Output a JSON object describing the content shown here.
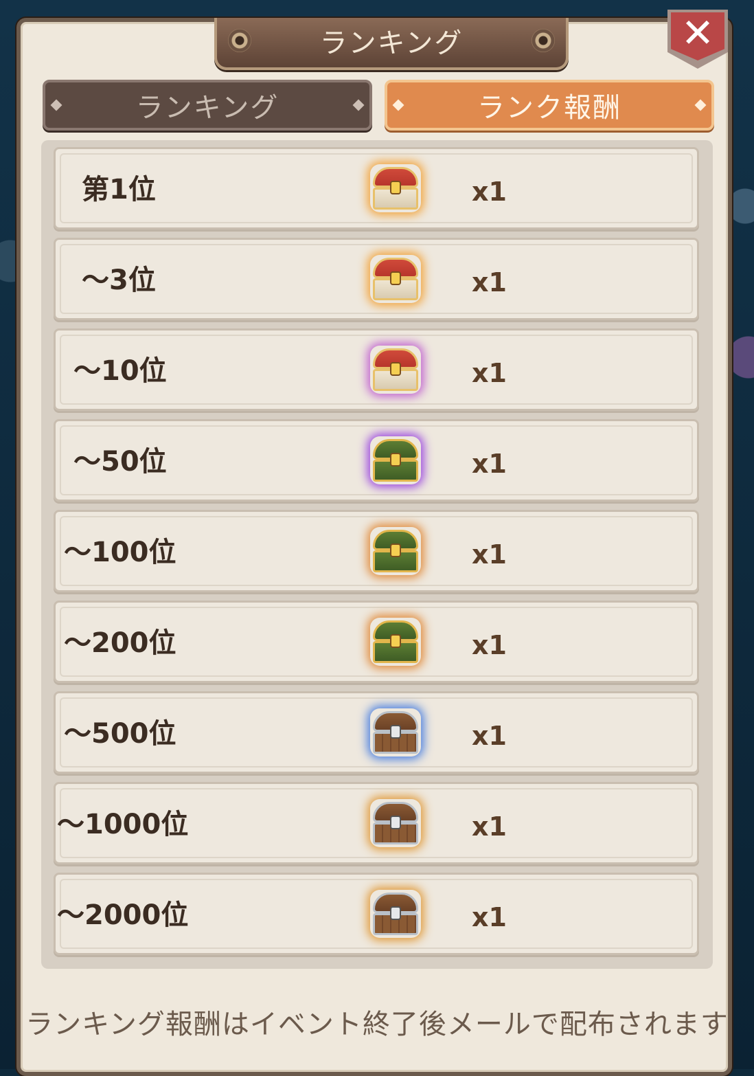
{
  "header": {
    "title": "ランキング",
    "close_label": "✕"
  },
  "tabs": [
    {
      "label": "ランキング",
      "active": false
    },
    {
      "label": "ランク報酬",
      "active": true
    }
  ],
  "rewards": [
    {
      "rank": "第1位",
      "chest": "red-gold-chest",
      "qty": "x1"
    },
    {
      "rank": "～3位",
      "chest": "red-gold-chest",
      "qty": "x1"
    },
    {
      "rank": "～10位",
      "chest": "red-gold-chest",
      "qty": "x1"
    },
    {
      "rank": "～50位",
      "chest": "green-gold-chest",
      "qty": "x1"
    },
    {
      "rank": "～100位",
      "chest": "green-gold-chest",
      "qty": "x1"
    },
    {
      "rank": "～200位",
      "chest": "green-gold-chest",
      "qty": "x1"
    },
    {
      "rank": "～500位",
      "chest": "wood-silver-chest",
      "qty": "x1"
    },
    {
      "rank": "～1000位",
      "chest": "wood-silver-chest",
      "qty": "x1"
    },
    {
      "rank": "～2000位",
      "chest": "wood-silver-chest",
      "qty": "x1"
    }
  ],
  "footer": {
    "note": "ランキング報酬はイベント終了後メールで配布されます"
  },
  "colors": {
    "active_tab": "#e08a4e",
    "inactive_tab": "#5c4a42",
    "panel": "#efe8dc",
    "close": "#b94747"
  }
}
